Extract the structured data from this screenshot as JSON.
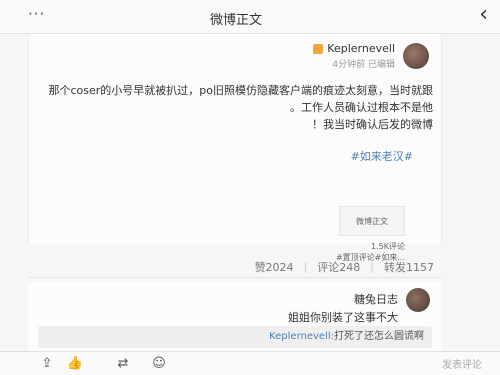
{
  "header": {
    "menu": "···",
    "title": "微博正文"
  },
  "post": {
    "author": "Keplernevell",
    "time": "4分钟前 已编辑",
    "lines": [
      "那个coser的小号早就被扒过，po旧照模仿隐藏客户端的痕迹太刻意，当时就跟",
      "工作人员确认过根本不是他。",
      "我当时确认后发的微博！"
    ],
    "hashtag": "#如来老汉#",
    "attachment_label": "微博正文",
    "attachment_note": "1.5K评论\n#置顶评论#如来..."
  },
  "tabs": [
    {
      "label": "转发1157"
    },
    {
      "label": "评论248"
    },
    {
      "label": "赞2024"
    }
  ],
  "comment": {
    "author": "糖兔日志",
    "text": "姐姐你别装了这事不大",
    "quote_mention": "Keplernevell:",
    "quote_text": "打死了还怎么圆谎啊"
  },
  "bottom": {
    "comment_placeholder": "发表评论"
  }
}
